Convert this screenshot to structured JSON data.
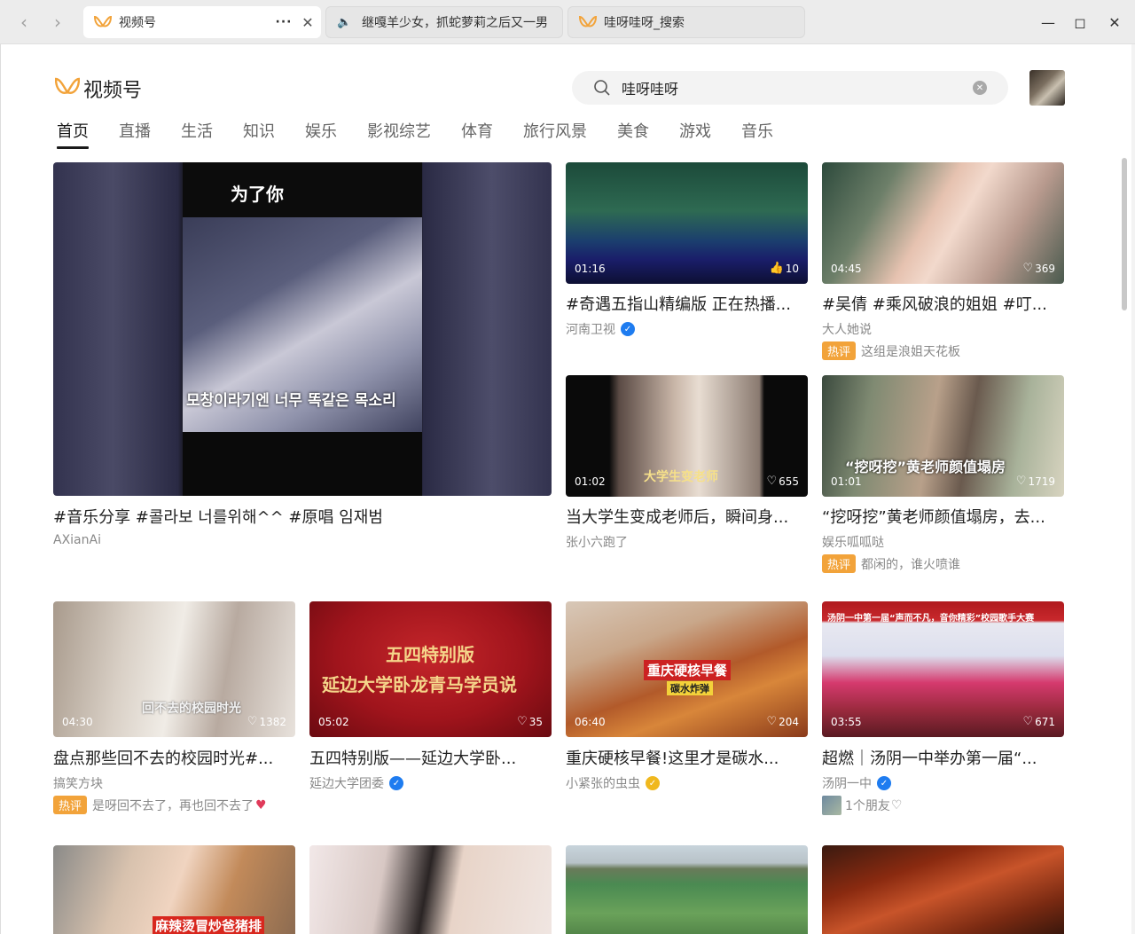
{
  "browser": {
    "tabs": [
      {
        "title": "视频号",
        "active": true
      },
      {
        "title": "继嘎羊少女，抓蛇萝莉之后又一男",
        "audio": true
      },
      {
        "title": "哇呀哇呀_搜索"
      }
    ]
  },
  "header": {
    "logo_text": "视频号",
    "search_value": "哇呀哇呀"
  },
  "categories": [
    "首页",
    "直播",
    "生活",
    "知识",
    "娱乐",
    "影视综艺",
    "体育",
    "旅行风景",
    "美食",
    "游戏",
    "音乐"
  ],
  "feed": {
    "featured": {
      "title": "#音乐分享 #콜라보 너를위해^^ #原唱 임재범",
      "author": "AXianAi",
      "overlay_top": "为了你",
      "overlay_caption": "모창이라기엔 너무 똑같은 목소리"
    },
    "cards": [
      {
        "title": "#奇遇五指山精编版 正在热播...",
        "author": "河南卫视",
        "duration": "01:16",
        "likes": "10",
        "verified": "blue"
      },
      {
        "title": "#吴倩 #乘风破浪的姐姐 #叮...",
        "author": "大人她说",
        "duration": "04:45",
        "likes": "369",
        "hot_badge": "热评",
        "hot_text": "这组是浪姐天花板"
      },
      {
        "title": "当大学生变成老师后，瞬间身...",
        "author": "张小六跑了",
        "duration": "01:02",
        "likes": "655",
        "overlay": "大学生变老师"
      },
      {
        "title": "“挖呀挖”黄老师颜值塌房，去...",
        "author": "娱乐呱呱哒",
        "duration": "01:01",
        "likes": "1719",
        "hot_badge": "热评",
        "hot_text": "都闲的，谁火喷谁",
        "overlay": "“挖呀挖”黄老师颜值塌房"
      },
      {
        "title": "盘点那些回不去的校园时光#...",
        "author": "搞笑方块",
        "duration": "04:30",
        "likes": "1382",
        "hot_badge": "热评",
        "hot_text": "是呀回不去了，再也回不去了",
        "overlay": "回不去的校园时光"
      },
      {
        "title": "五四特别版——延边大学卧...",
        "author": "延边大学团委",
        "duration": "05:02",
        "likes": "35",
        "verified": "blue",
        "overlay_line1": "五四特别版",
        "overlay_line2": "延边大学卧龙青马学员说"
      },
      {
        "title": "重庆硬核早餐!这里才是碳水...",
        "author": "小紧张的虫虫",
        "duration": "06:40",
        "likes": "204",
        "verified": "gold",
        "overlay": "重庆硬核早餐",
        "overlay_sub": "碳水炸弹"
      },
      {
        "title": "超燃｜汤阴一中举办第一届“...",
        "author": "汤阴一中",
        "duration": "03:55",
        "likes": "671",
        "verified": "blue",
        "friends_text": "1个朋友",
        "overlay": "汤阴一中第一届“声而不凡，音你精彩”校园歌手大赛"
      }
    ],
    "bottom_row": [
      {
        "overlay": "麻辣烫冒炒爸猪排"
      },
      {},
      {},
      {}
    ]
  },
  "colors": {
    "accent": "#f2a33a",
    "verified_blue": "#1e7cf0",
    "verified_gold": "#f0b81e",
    "audio_green": "#2aae4b"
  },
  "icons": [
    "back-arrow-icon",
    "forward-arrow-icon",
    "channels-logo-icon",
    "more-icon",
    "close-icon",
    "speaker-icon",
    "minimize-icon",
    "maximize-icon",
    "window-close-icon",
    "search-icon",
    "clear-icon",
    "heart-icon",
    "verified-icon"
  ]
}
